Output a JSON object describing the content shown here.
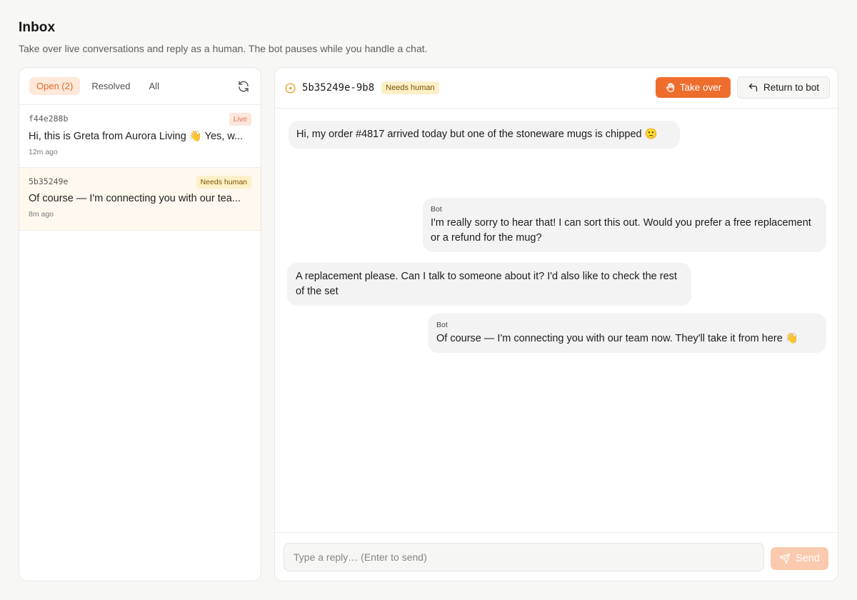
{
  "page": {
    "title": "Inbox",
    "subtitle": "Take over live conversations and reply as a human. The bot pauses while you handle a chat."
  },
  "tabs": [
    {
      "label": "Open (2)",
      "active": true
    },
    {
      "label": "Resolved",
      "active": false
    },
    {
      "label": "All",
      "active": false
    }
  ],
  "conversations": [
    {
      "id": "f44e288b",
      "badge": "Live",
      "preview": "Hi, this is Greta from Aurora Living 👋  Yes, w...",
      "time": "12m ago"
    },
    {
      "id": "5b35249e",
      "badge": "Needs human",
      "preview": "Of course — I'm connecting you with our tea...",
      "time": "8m ago"
    }
  ],
  "chat": {
    "id": "5b35249e-9b8",
    "badge": "Needs human",
    "take_over_label": "Take over",
    "return_label": "Return to bot",
    "messages": [
      {
        "sender": "",
        "text": "Hi, my order #4817 arrived today but one of the stoneware mugs is chipped 🙁"
      },
      {
        "sender": "Bot",
        "text": "I'm really sorry to hear that! I can sort this out. Would you prefer a free replacement or a refund for the mug?"
      },
      {
        "sender": "",
        "text": "A replacement please. Can I talk to someone about it? I'd also like to check the rest of the set"
      },
      {
        "sender": "Bot",
        "text": "Of course — I'm connecting you with our team now. They'll take it from here 👋"
      }
    ]
  },
  "composer": {
    "placeholder": "Type a reply… (Enter to send)",
    "send_label": "Send"
  },
  "colors": {
    "accent": "#ee6d2d",
    "accent_soft": "#fde8da",
    "send_disabled": "#fbc9ad",
    "needs_human_bg": "#fdf0c8",
    "live_bg": "#fde6dc"
  },
  "icons": {
    "refresh": "refresh-icon",
    "status": "status-circle-icon",
    "take_over": "hand-icon",
    "return": "return-arrow-icon",
    "send": "send-icon"
  }
}
